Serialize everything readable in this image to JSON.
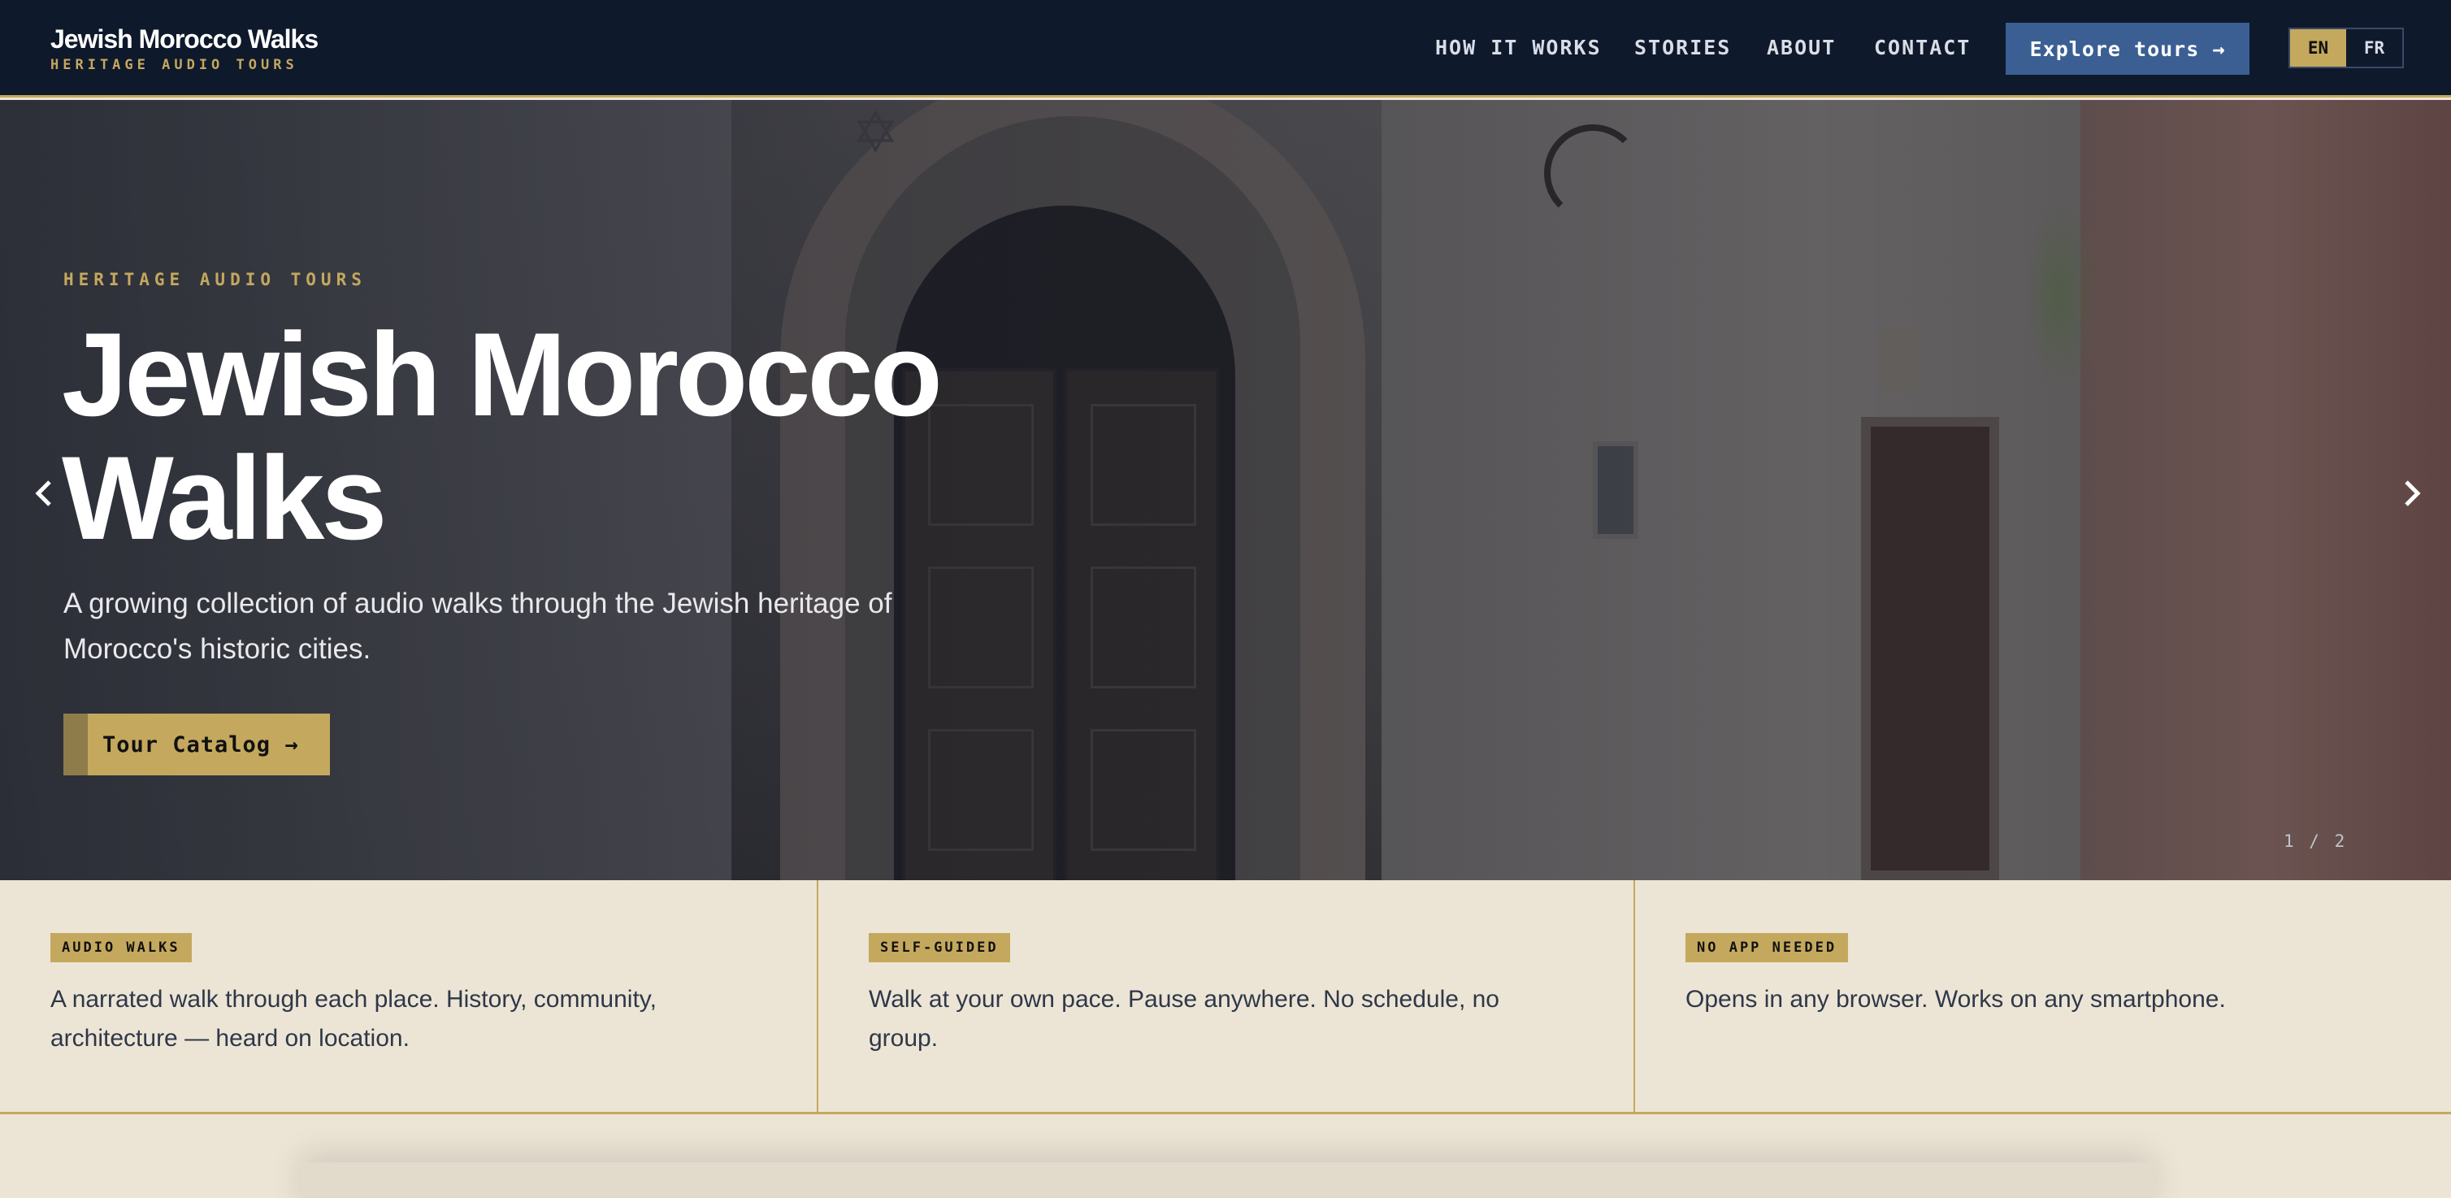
{
  "header": {
    "brand_name": "Jewish Morocco Walks",
    "brand_tagline": "HERITAGE AUDIO TOURS",
    "nav": [
      "HOW IT WORKS",
      "STORIES",
      "ABOUT",
      "CONTACT"
    ],
    "cta_label": "Explore tours →",
    "languages": [
      "EN",
      "FR"
    ],
    "active_language": "EN"
  },
  "hero": {
    "eyebrow": "HERITAGE AUDIO TOURS",
    "title": "Jewish Morocco Walks",
    "description": "A growing collection of audio walks through the Jewish heritage of Morocco's historic cities.",
    "cta_label": "Tour Catalog →",
    "slide_counter": "1 / 2"
  },
  "features": [
    {
      "badge": "AUDIO WALKS",
      "text": "A narrated walk through each place. History, community, architecture — heard on location."
    },
    {
      "badge": "SELF-GUIDED",
      "text": "Walk at your own pace. Pause anywhere. No schedule, no group."
    },
    {
      "badge": "NO APP NEEDED",
      "text": "Opens in any browser. Works on any smartphone."
    }
  ],
  "colors": {
    "navy": "#0f192c",
    "gold": "#c4a85d",
    "blue_button": "#3b5f93",
    "cream": "#ece5d6",
    "text_dark": "#2f3848"
  },
  "icons": [
    "chevron-left-icon",
    "chevron-right-icon",
    "arrow-right-icon"
  ]
}
